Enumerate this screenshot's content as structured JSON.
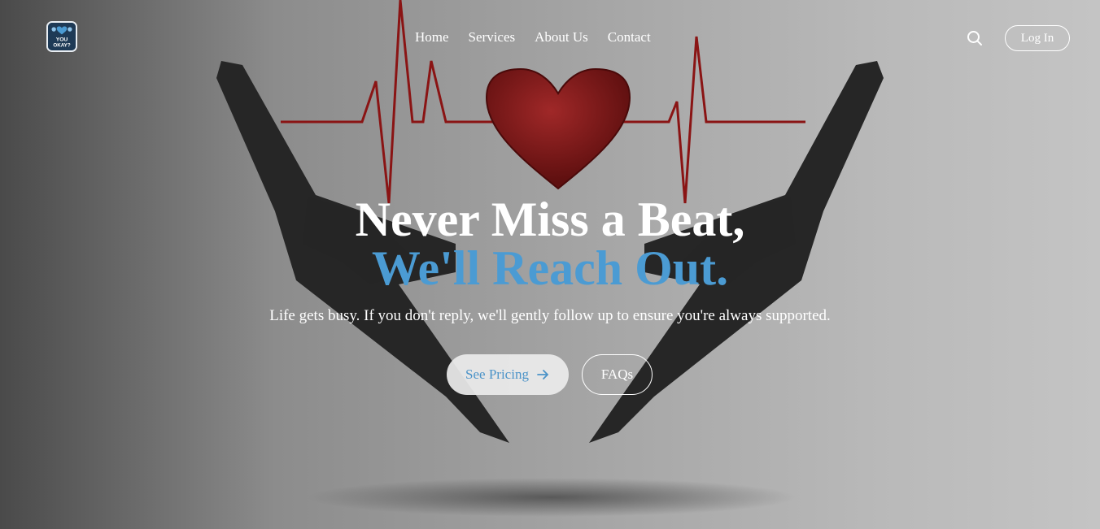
{
  "brand": {
    "logo_text": "YOU OKAY?"
  },
  "nav": {
    "links": [
      {
        "label": "Home"
      },
      {
        "label": "Services"
      },
      {
        "label": "About Us"
      },
      {
        "label": "Contact"
      }
    ],
    "search_icon": "search-icon",
    "login_label": "Log In"
  },
  "hero": {
    "headline_line1": "Never Miss a Beat,",
    "headline_line2": "We'll Reach Out.",
    "subtitle": "Life gets busy. If you don't reply, we'll gently follow up to ensure you're always supported.",
    "primary_cta": {
      "label": "See Pricing",
      "icon": "arrow-right-icon"
    },
    "secondary_cta": {
      "label": "FAQs"
    }
  },
  "colors": {
    "accent": "#4b9bd3",
    "heart": "#7a1515",
    "hands": "#262626"
  }
}
